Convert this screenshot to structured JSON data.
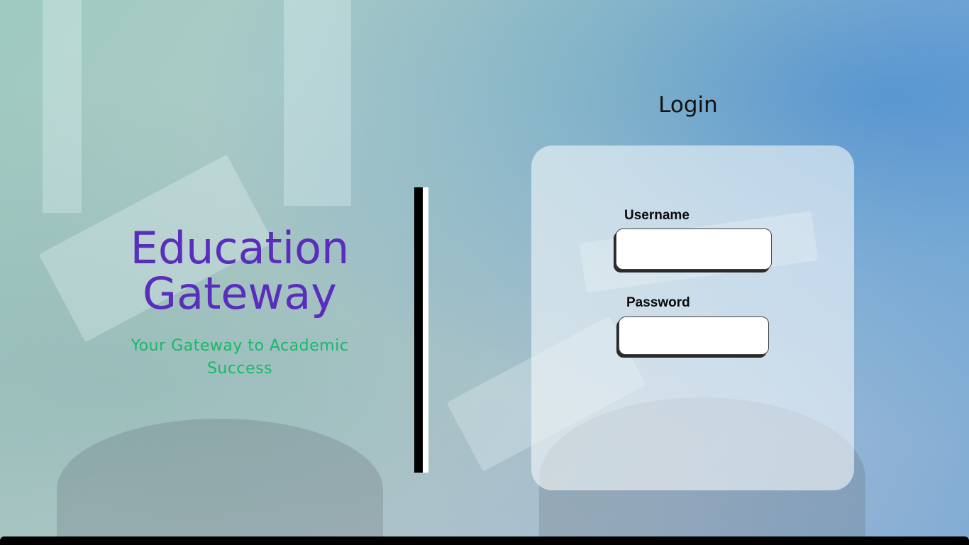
{
  "brand": {
    "title_line1": "Education",
    "title_line2": "Gateway",
    "subtitle": "Your Gateway to Academic Success",
    "title_color": "#5a2dbd",
    "subtitle_color": "#18b96a"
  },
  "login": {
    "heading": "Login",
    "username_label": "Username",
    "username_value": "",
    "password_label": "Password",
    "password_value": ""
  }
}
